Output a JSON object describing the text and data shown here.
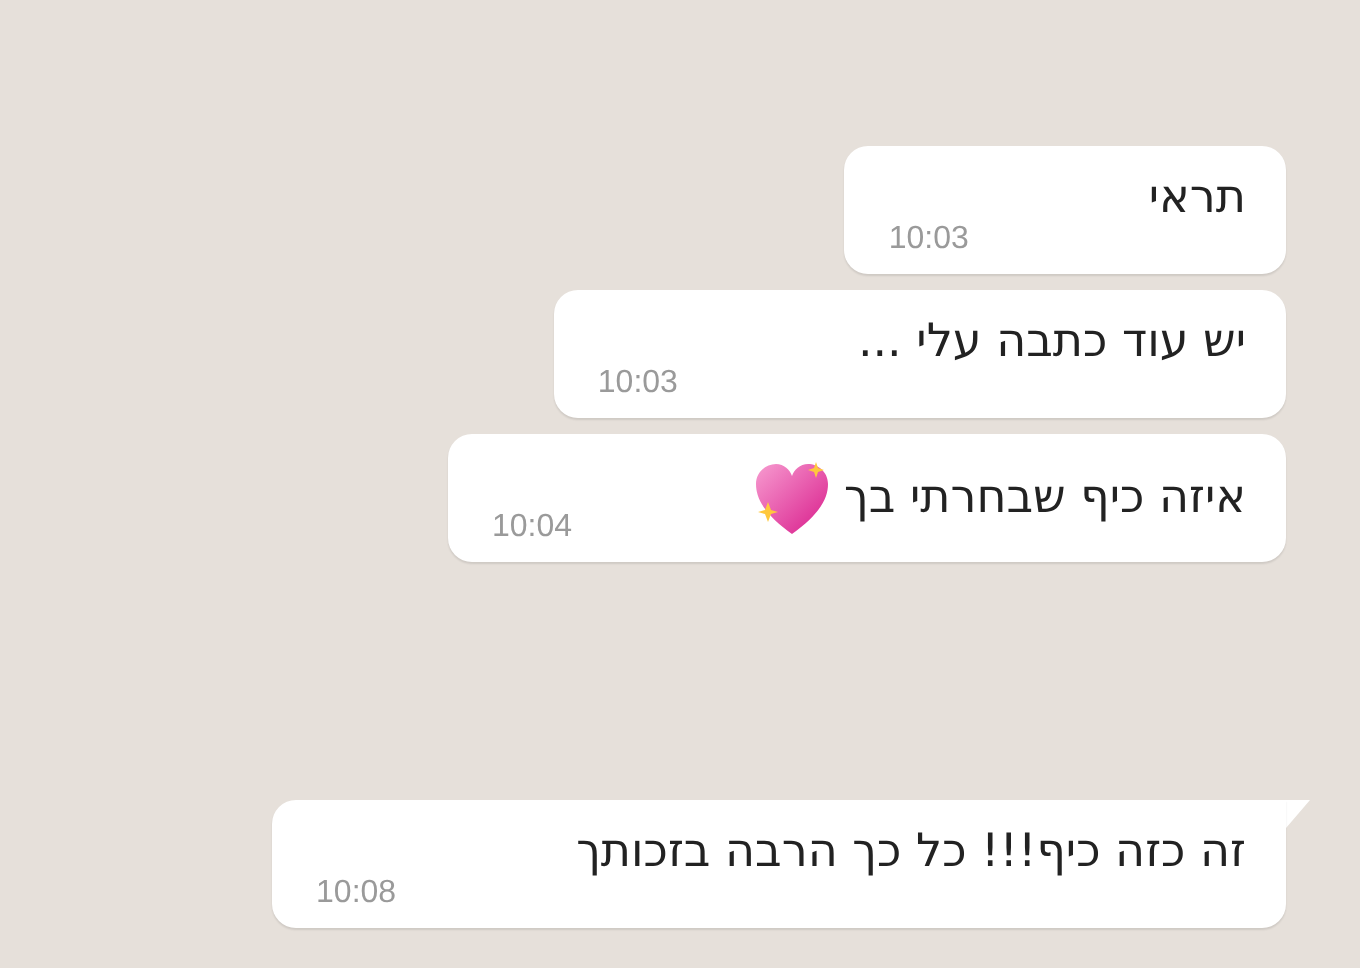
{
  "messages": [
    {
      "text": "תראי",
      "time": "10:03",
      "tail": false
    },
    {
      "text": "יש עוד כתבה עלי ...",
      "time": "10:03",
      "tail": false
    },
    {
      "text": "איזה כיף שבחרתי בך",
      "time": "10:04",
      "tail": false,
      "emoji": true
    },
    {
      "text": "זה כזה כיף!!! כל כך הרבה בזכותך",
      "time": "10:08",
      "tail": true
    }
  ]
}
